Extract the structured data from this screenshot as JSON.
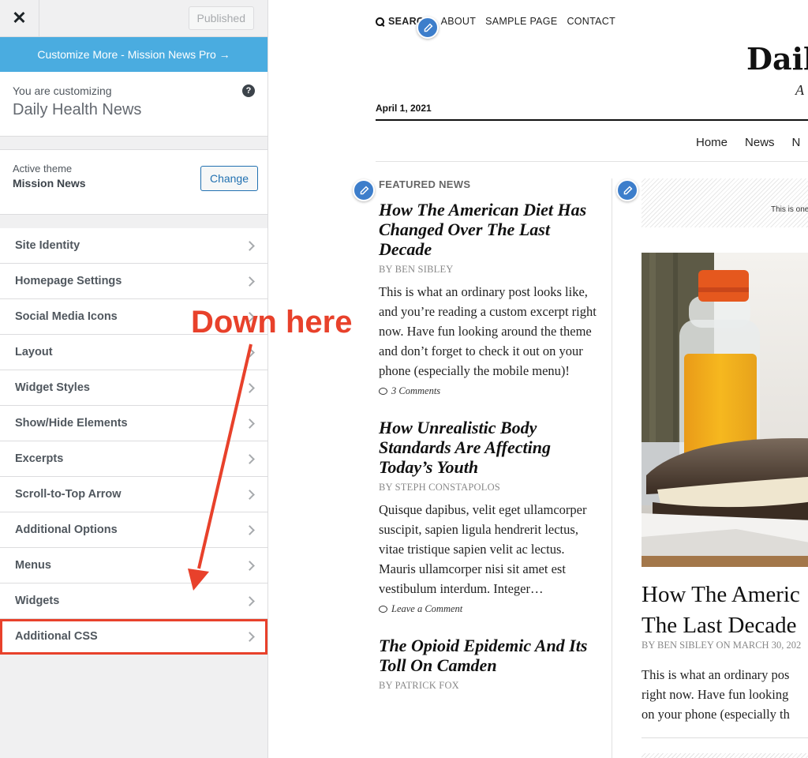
{
  "sidebar": {
    "close_label": "✕",
    "published_label": "Published",
    "upsell_label": "Customize More - Mission News Pro →",
    "customizing_label": "You are customizing",
    "site_name": "Daily Health News",
    "help_label": "?",
    "active_theme_label": "Active theme",
    "theme_name": "Mission News",
    "change_label": "Change",
    "items": [
      {
        "label": "Site Identity"
      },
      {
        "label": "Homepage Settings"
      },
      {
        "label": "Social Media Icons"
      },
      {
        "label": "Layout"
      },
      {
        "label": "Widget Styles"
      },
      {
        "label": "Show/Hide Elements"
      },
      {
        "label": "Excerpts"
      },
      {
        "label": "Scroll-to-Top Arrow"
      },
      {
        "label": "Additional Options"
      },
      {
        "label": "Menus"
      },
      {
        "label": "Widgets"
      },
      {
        "label": "Additional CSS",
        "highlighted": true
      }
    ]
  },
  "annotation": {
    "text": "Down here",
    "color": "#e8412b"
  },
  "preview": {
    "top_nav": {
      "search": "SEARCH",
      "links": [
        "ABOUT",
        "SAMPLE PAGE",
        "CONTACT"
      ]
    },
    "site_title": "Daily",
    "tagline": "A",
    "date": "April 1, 2021",
    "main_nav": [
      "Home",
      "News",
      "N"
    ],
    "featured_label": "FEATURED NEWS",
    "posts": [
      {
        "title": "How The American Diet Has Changed Over The Last Decade",
        "byline": "BY BEN SIBLEY",
        "excerpt": "This is what an ordinary post looks like, and you’re reading a custom excerpt right now. Have fun looking around the theme and don’t forget to check it out on your phone (especially the mobile menu)!",
        "comments": "3 Comments"
      },
      {
        "title": "How Unrealistic Body Standards Are Affecting Today’s Youth",
        "byline": "BY STEPH CONSTAPOLOS",
        "excerpt": "Quisque dapibus, velit eget ullamcorper suscipit, sapien ligula hendrerit lectus, vitae tristique sapien velit ac lectus. Mauris ullamcorper nisi sit amet est vestibulum interdum. Integer…",
        "comments": "Leave a Comment"
      },
      {
        "title": "The Opioid Epidemic And Its Toll On Camden",
        "byline": "BY PATRICK FOX"
      }
    ],
    "widget_text": "This is one",
    "hero": {
      "title_line1": "How The Americ",
      "title_line2": "The Last Decade",
      "byline": "BY BEN SIBLEY ON MARCH 30, 202",
      "excerpt_lines": [
        "This is what an ordinary pos",
        "right now. Have fun looking",
        "on your phone (especially th"
      ]
    },
    "accent_color": "#3d7ecb"
  }
}
